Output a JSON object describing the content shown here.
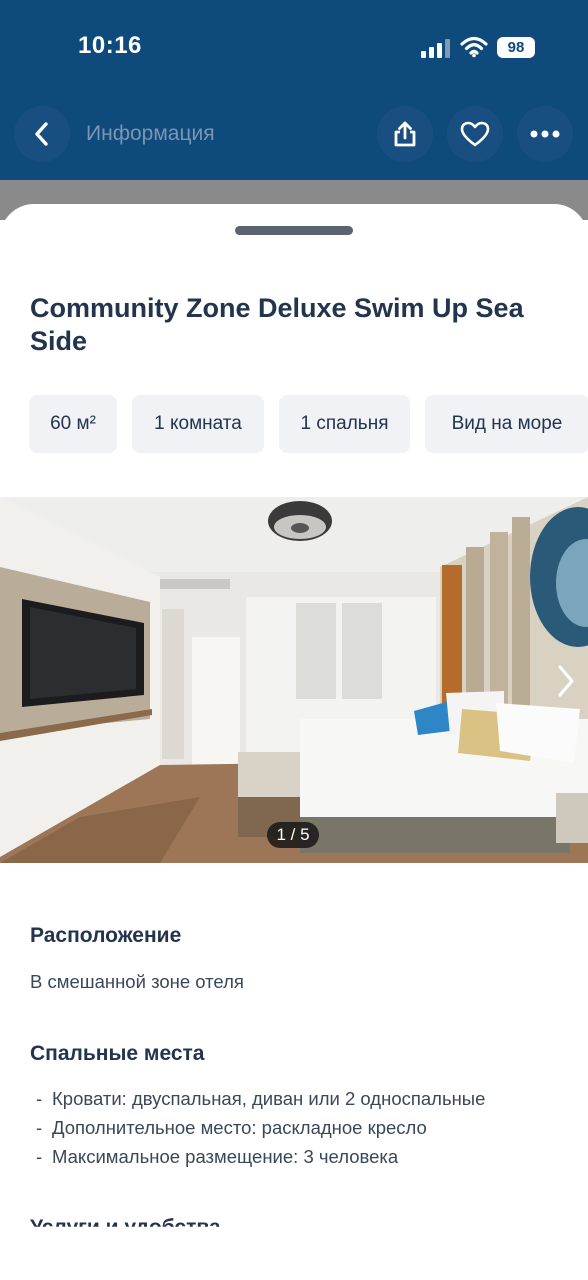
{
  "status_bar": {
    "time": "10:16",
    "battery": "98"
  },
  "nav": {
    "title": "Информация",
    "back_icon": "chevron-left-icon",
    "share_icon": "share-icon",
    "favorite_icon": "heart-icon",
    "more_icon": "more-dots-icon"
  },
  "room": {
    "title": "Community Zone Deluxe Swim Up Sea Side",
    "chips": [
      "60 м²",
      "1 комната",
      "1 спальня",
      "Вид на море"
    ]
  },
  "gallery": {
    "counter": "1 / 5",
    "current": 1,
    "total": 5
  },
  "location": {
    "title": "Расположение",
    "text": "В смешанной зоне отеля"
  },
  "beds": {
    "title": "Спальные места",
    "items": [
      "Кровати: двуспальная, диван или 2 односпальные",
      "Дополнительное место: раскладное кресло",
      "Максимальное размещение: 3 человека"
    ]
  },
  "amenities": {
    "title": "Услуги и удобства"
  },
  "colors": {
    "header_bg": "#0e4a7c",
    "title_text": "#23344d",
    "chip_bg": "#f0f2f5"
  }
}
